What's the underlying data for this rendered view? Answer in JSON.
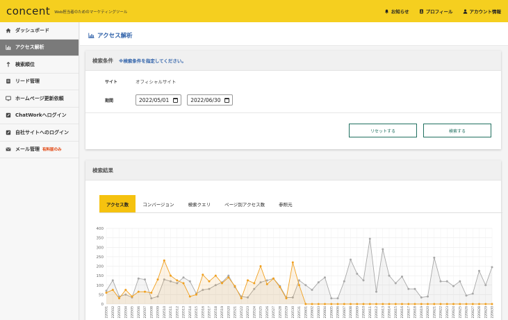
{
  "header": {
    "logo": "concent",
    "tagline": "Web担当者のためのマーケティングツール",
    "nav": [
      {
        "label": "お知らせ",
        "icon": "bell-icon"
      },
      {
        "label": "プロフィール",
        "icon": "profile-icon"
      },
      {
        "label": "アカウント情報",
        "icon": "user-icon"
      }
    ]
  },
  "sidebar": {
    "items": [
      {
        "label": "ダッシュボード",
        "icon": "home-icon"
      },
      {
        "label": "アクセス解析",
        "icon": "bar-chart-icon",
        "active": true
      },
      {
        "label": "検索順位",
        "icon": "ranking-icon"
      },
      {
        "label": "リード管理",
        "icon": "lead-icon"
      },
      {
        "label": "ホームページ更新依頼",
        "icon": "monitor-icon"
      },
      {
        "label": "ChatWorkへログイン",
        "icon": "edit-icon"
      },
      {
        "label": "自社サイトへのログイン",
        "icon": "edit-icon"
      },
      {
        "label": "メール管理",
        "icon": "mail-icon",
        "badge": "有料版のみ"
      }
    ]
  },
  "page": {
    "title": "アクセス解析"
  },
  "search": {
    "heading": "検索条件",
    "note": "※検索条件を指定してください。",
    "site_label": "サイト",
    "site_value": "オフィシャルサイト",
    "period_label": "期間",
    "date_from": "2022/05/01",
    "date_to": "2022/06/30",
    "reset_label": "リセットする",
    "search_label": "検索する"
  },
  "results": {
    "heading": "検索結果",
    "tabs": [
      "アクセス数",
      "コンバージョン",
      "検索クエリ",
      "ページ別アクセス数",
      "参照元"
    ]
  },
  "chart_data": {
    "type": "line",
    "ylim": [
      0,
      400
    ],
    "yticks": [
      0,
      50,
      100,
      150,
      200,
      250,
      300,
      350,
      400
    ],
    "x": [
      "220501",
      "220502",
      "220503",
      "220504",
      "220505",
      "220506",
      "220507",
      "220508",
      "220509",
      "220510",
      "220511",
      "220512",
      "220513",
      "220514",
      "220515",
      "220516",
      "220517",
      "220518",
      "220519",
      "220520",
      "220521",
      "220522",
      "220523",
      "220524",
      "220525",
      "220526",
      "220527",
      "220528",
      "220529",
      "220530",
      "220531",
      "220601",
      "220602",
      "220603",
      "220604",
      "220605",
      "220606",
      "220607",
      "220608",
      "220609",
      "220610",
      "220611",
      "220612",
      "220613",
      "220614",
      "220615",
      "220616",
      "220617",
      "220618",
      "220619",
      "220620",
      "220621",
      "220622",
      "220623",
      "220624",
      "220625",
      "220626",
      "220627",
      "220628",
      "220629",
      "220630"
    ],
    "series": [
      {
        "color": "#f0a020",
        "values": [
          60,
          75,
          30,
          75,
          40,
          65,
          65,
          60,
          130,
          230,
          150,
          125,
          110,
          40,
          50,
          155,
          120,
          150,
          110,
          140,
          95,
          30,
          125,
          110,
          200,
          105,
          135,
          90,
          30,
          220,
          100,
          0,
          0,
          0,
          0,
          0,
          0,
          0,
          0,
          0,
          0,
          0,
          0,
          0,
          0,
          0,
          0,
          0,
          0,
          0,
          0,
          0,
          0,
          0,
          0,
          0,
          0,
          0,
          0,
          0,
          0
        ]
      },
      {
        "color": "#a8a8a8",
        "values": [
          70,
          125,
          40,
          50,
          35,
          135,
          130,
          30,
          40,
          130,
          120,
          110,
          140,
          120,
          55,
          75,
          80,
          100,
          115,
          150,
          90,
          40,
          35,
          80,
          115,
          125,
          135,
          95,
          35,
          35,
          125,
          100,
          75,
          115,
          140,
          30,
          30,
          120,
          235,
          160,
          125,
          345,
          65,
          290,
          150,
          110,
          145,
          80,
          80,
          35,
          40,
          245,
          120,
          120,
          95,
          120,
          45,
          55,
          175,
          100,
          195
        ]
      }
    ]
  }
}
